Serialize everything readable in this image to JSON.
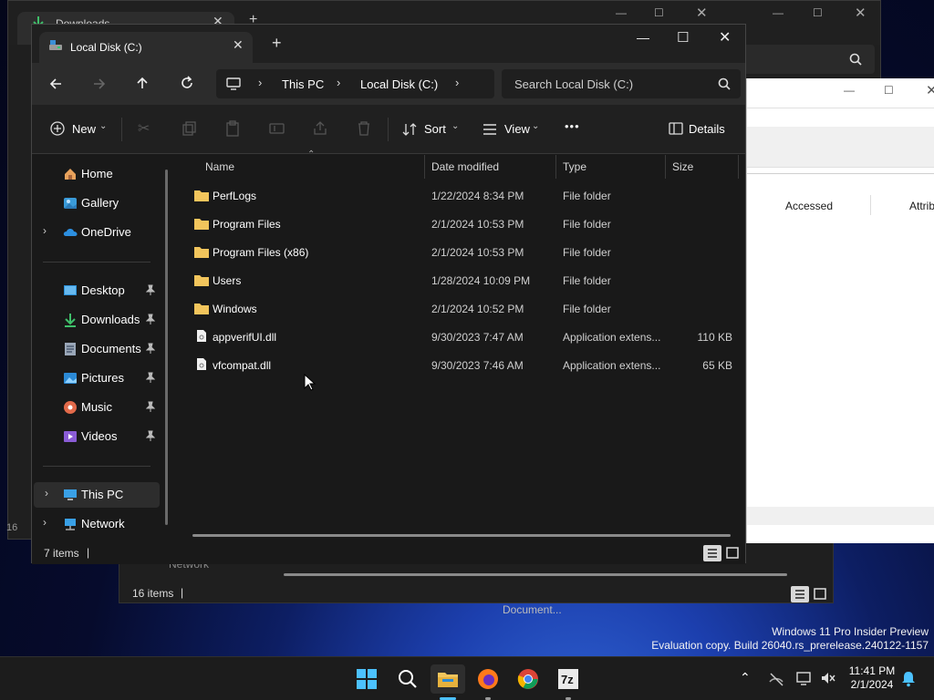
{
  "back_window": {
    "tab_title": "Downloads",
    "search_icon": "search-icon",
    "status_items": "16",
    "network_label": "Network",
    "taskbar_tooltip": "Document..."
  },
  "back2_window": {
    "status": "16 items",
    "network_label": "Network"
  },
  "light_window": {
    "col_accessed": "Accessed",
    "col_attributes": "Attrib"
  },
  "main_window": {
    "tab_title": "Local Disk (C:)",
    "breadcrumb": [
      "This PC",
      "Local Disk (C:)"
    ],
    "search_placeholder": "Search Local Disk (C:)",
    "toolbar": {
      "new_label": "New",
      "sort_label": "Sort",
      "view_label": "View",
      "more_label": "•••",
      "details_label": "Details"
    },
    "sidebar": {
      "home": "Home",
      "gallery": "Gallery",
      "onedrive": "OneDrive",
      "desktop": "Desktop",
      "downloads": "Downloads",
      "documents": "Documents",
      "pictures": "Pictures",
      "music": "Music",
      "videos": "Videos",
      "thispc": "This PC",
      "network": "Network"
    },
    "columns": {
      "name": "Name",
      "date": "Date modified",
      "type": "Type",
      "size": "Size"
    },
    "files": [
      {
        "name": "PerfLogs",
        "date": "1/22/2024 8:34 PM",
        "type": "File folder",
        "size": "",
        "kind": "folder"
      },
      {
        "name": "Program Files",
        "date": "2/1/2024 10:53 PM",
        "type": "File folder",
        "size": "",
        "kind": "folder"
      },
      {
        "name": "Program Files (x86)",
        "date": "2/1/2024 10:53 PM",
        "type": "File folder",
        "size": "",
        "kind": "folder"
      },
      {
        "name": "Users",
        "date": "1/28/2024 10:09 PM",
        "type": "File folder",
        "size": "",
        "kind": "folder"
      },
      {
        "name": "Windows",
        "date": "2/1/2024 10:52 PM",
        "type": "File folder",
        "size": "",
        "kind": "folder"
      },
      {
        "name": "appverifUI.dll",
        "date": "9/30/2023 7:47 AM",
        "type": "Application extens...",
        "size": "110 KB",
        "kind": "dll"
      },
      {
        "name": "vfcompat.dll",
        "date": "9/30/2023 7:46 AM",
        "type": "Application extens...",
        "size": "65 KB",
        "kind": "dll"
      }
    ],
    "status": "7 items"
  },
  "watermark": {
    "line1": "Windows 11 Pro Insider Preview",
    "line2": "Evaluation copy. Build 26040.rs_prerelease.240122-1157"
  },
  "clock": {
    "time": "11:41 PM",
    "date": "2/1/2024"
  },
  "colors": {
    "folder": "#f2c55c",
    "accent": "#4cc2ff"
  }
}
